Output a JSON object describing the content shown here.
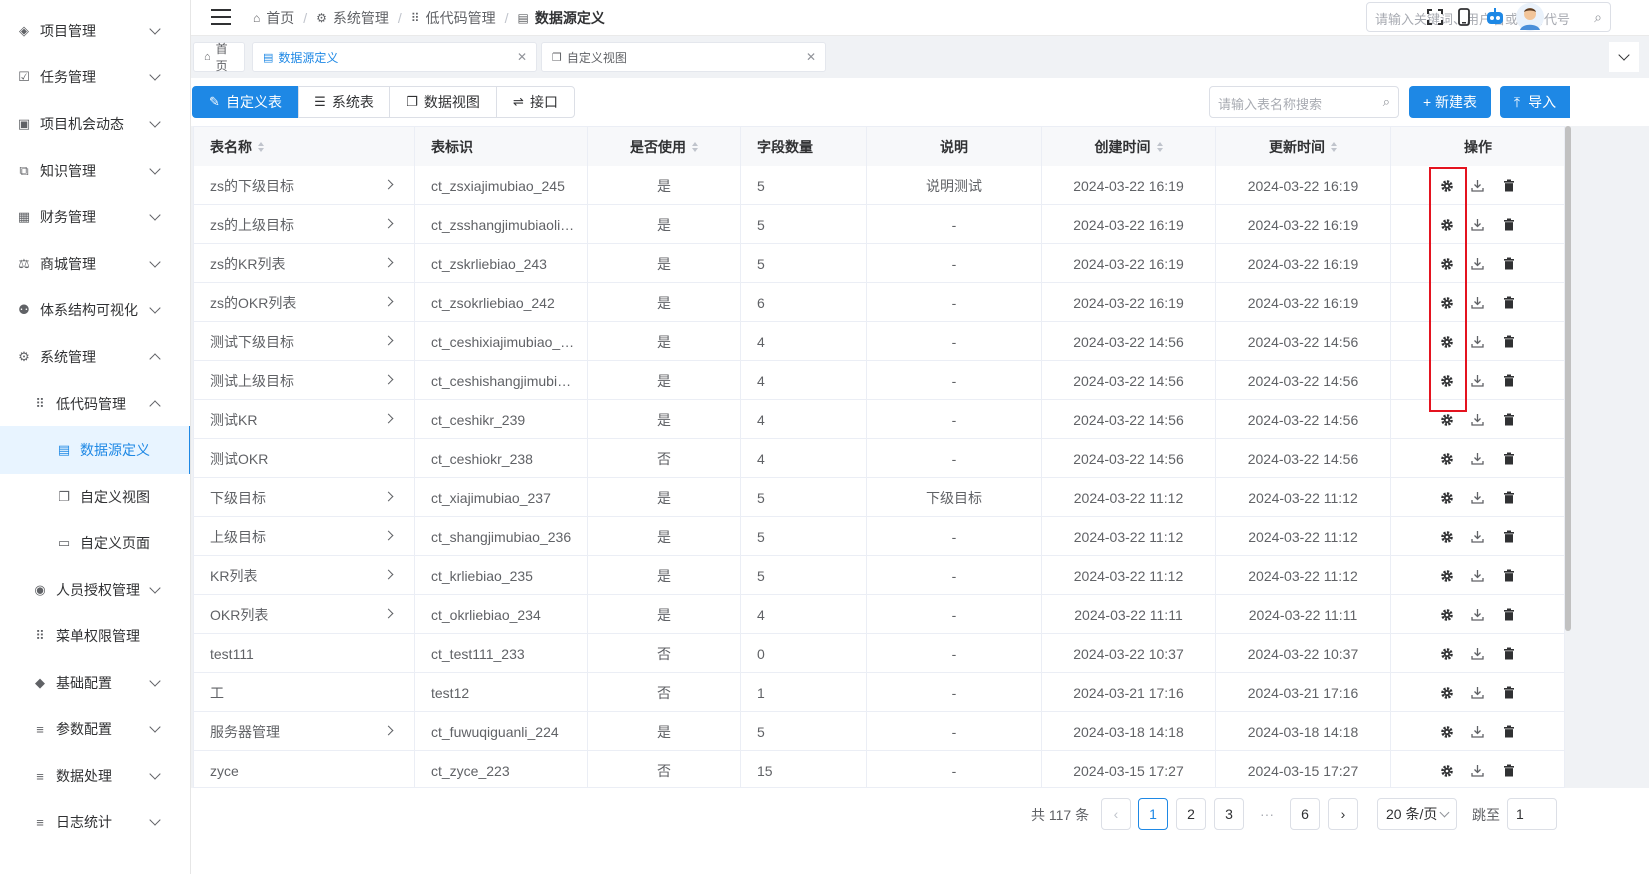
{
  "sidebar": {
    "items": [
      {
        "label": "项目管理",
        "icon": "layers-icon",
        "glyph": "◈",
        "expand": "down"
      },
      {
        "label": "任务管理",
        "icon": "task-check-icon",
        "glyph": "☑",
        "expand": "down"
      },
      {
        "label": "项目机会动态",
        "icon": "calendar-icon",
        "glyph": "▣",
        "expand": "down"
      },
      {
        "label": "知识管理",
        "icon": "book-icon",
        "glyph": "⧉",
        "expand": "down"
      },
      {
        "label": "财务管理",
        "icon": "grid-icon",
        "glyph": "▦",
        "expand": "down"
      },
      {
        "label": "商城管理",
        "icon": "shop-icon",
        "glyph": "⚖",
        "expand": "down"
      },
      {
        "label": "体系结构可视化",
        "icon": "user-tree-icon",
        "glyph": "⚉",
        "expand": "down"
      },
      {
        "label": "系统管理",
        "icon": "gear-icon",
        "glyph": "⚙",
        "expand": "up"
      },
      {
        "label": "低代码管理",
        "icon": "dots-grid-icon",
        "glyph": "⠿",
        "expand": "up"
      },
      {
        "label": "数据源定义",
        "icon": "document-icon",
        "glyph": "▤",
        "expand": "none",
        "active": true
      },
      {
        "label": "自定义视图",
        "icon": "copy-icon",
        "glyph": "❐",
        "expand": "none"
      },
      {
        "label": "自定义页面",
        "icon": "window-icon",
        "glyph": "▭",
        "expand": "none"
      },
      {
        "label": "人员授权管理",
        "icon": "user-circle-icon",
        "glyph": "◉",
        "expand": "down"
      },
      {
        "label": "菜单权限管理",
        "icon": "dots-grid-icon",
        "glyph": "⠿",
        "expand": "none"
      },
      {
        "label": "基础配置",
        "icon": "cube-icon",
        "glyph": "◆",
        "expand": "down"
      },
      {
        "label": "参数配置",
        "icon": "filter-icon",
        "glyph": "≡",
        "expand": "down"
      },
      {
        "label": "数据处理",
        "icon": "filter-icon",
        "glyph": "≡",
        "expand": "down"
      },
      {
        "label": "日志统计",
        "icon": "filter-icon",
        "glyph": "≡",
        "expand": "down"
      }
    ]
  },
  "breadcrumb": {
    "items": [
      "首页",
      "系统管理",
      "低代码管理",
      "数据源定义"
    ]
  },
  "global_search": {
    "placeholder": "请输入关键词、用户名或项目代号"
  },
  "tabs": [
    {
      "label": "首页"
    },
    {
      "label": "数据源定义",
      "active": true
    },
    {
      "label": "自定义视图"
    }
  ],
  "toolbar": {
    "segments": [
      {
        "label": "自定义表",
        "active": true
      },
      {
        "label": "系统表"
      },
      {
        "label": "数据视图"
      },
      {
        "label": "接口"
      }
    ],
    "search_placeholder": "请输入表名称搜索",
    "new_label": "+ 新建表",
    "import_label": "导入"
  },
  "table": {
    "headers": [
      "表名称",
      "表标识",
      "是否使用",
      "字段数量",
      "说明",
      "创建时间",
      "更新时间",
      "操作"
    ],
    "rows": [
      {
        "name": "zs的下级目标",
        "id": "ct_zsxiajimubiao_245",
        "used": "是",
        "fields": "5",
        "desc": "说明测试",
        "created": "2024-03-22 16:19",
        "updated": "2024-03-22 16:19",
        "arrow": true
      },
      {
        "name": "zs的上级目标",
        "id": "ct_zsshangjimubiaoli…",
        "used": "是",
        "fields": "5",
        "desc": "-",
        "created": "2024-03-22 16:19",
        "updated": "2024-03-22 16:19",
        "arrow": true
      },
      {
        "name": "zs的KR列表",
        "id": "ct_zskrliebiao_243",
        "used": "是",
        "fields": "5",
        "desc": "-",
        "created": "2024-03-22 16:19",
        "updated": "2024-03-22 16:19",
        "arrow": true
      },
      {
        "name": "zs的OKR列表",
        "id": "ct_zsokrliebiao_242",
        "used": "是",
        "fields": "6",
        "desc": "-",
        "created": "2024-03-22 16:19",
        "updated": "2024-03-22 16:19",
        "arrow": true
      },
      {
        "name": "测试下级目标",
        "id": "ct_ceshixiajimubiao_…",
        "used": "是",
        "fields": "4",
        "desc": "-",
        "created": "2024-03-22 14:56",
        "updated": "2024-03-22 14:56",
        "arrow": true
      },
      {
        "name": "测试上级目标",
        "id": "ct_ceshishangjimubi…",
        "used": "是",
        "fields": "4",
        "desc": "-",
        "created": "2024-03-22 14:56",
        "updated": "2024-03-22 14:56",
        "arrow": true
      },
      {
        "name": "测试KR",
        "id": "ct_ceshikr_239",
        "used": "是",
        "fields": "4",
        "desc": "-",
        "created": "2024-03-22 14:56",
        "updated": "2024-03-22 14:56",
        "arrow": true
      },
      {
        "name": "测试OKR",
        "id": "ct_ceshiokr_238",
        "used": "否",
        "fields": "4",
        "desc": "-",
        "created": "2024-03-22 14:56",
        "updated": "2024-03-22 14:56",
        "arrow": false
      },
      {
        "name": "下级目标",
        "id": "ct_xiajimubiao_237",
        "used": "是",
        "fields": "5",
        "desc": "下级目标",
        "created": "2024-03-22 11:12",
        "updated": "2024-03-22 11:12",
        "arrow": true
      },
      {
        "name": "上级目标",
        "id": "ct_shangjimubiao_236",
        "used": "是",
        "fields": "5",
        "desc": "-",
        "created": "2024-03-22 11:12",
        "updated": "2024-03-22 11:12",
        "arrow": true
      },
      {
        "name": "KR列表",
        "id": "ct_krliebiao_235",
        "used": "是",
        "fields": "5",
        "desc": "-",
        "created": "2024-03-22 11:12",
        "updated": "2024-03-22 11:12",
        "arrow": true
      },
      {
        "name": "OKR列表",
        "id": "ct_okrliebiao_234",
        "used": "是",
        "fields": "4",
        "desc": "-",
        "created": "2024-03-22 11:11",
        "updated": "2024-03-22 11:11",
        "arrow": true
      },
      {
        "name": "test111",
        "id": "ct_test111_233",
        "used": "否",
        "fields": "0",
        "desc": "-",
        "created": "2024-03-22 10:37",
        "updated": "2024-03-22 10:37",
        "arrow": false
      },
      {
        "name": "工",
        "id": "test12",
        "used": "否",
        "fields": "1",
        "desc": "-",
        "created": "2024-03-21 17:16",
        "updated": "2024-03-21 17:16",
        "arrow": false
      },
      {
        "name": "服务器管理",
        "id": "ct_fuwuqiguanli_224",
        "used": "是",
        "fields": "5",
        "desc": "-",
        "created": "2024-03-18 14:18",
        "updated": "2024-03-18 14:18",
        "arrow": true
      },
      {
        "name": "zyce",
        "id": "ct_zyce_223",
        "used": "否",
        "fields": "15",
        "desc": "-",
        "created": "2024-03-15 17:27",
        "updated": "2024-03-15 17:27",
        "arrow": false
      }
    ]
  },
  "pagination": {
    "total": "共 117 条",
    "pages": [
      "1",
      "2",
      "3",
      "···",
      "6"
    ],
    "current": "1",
    "page_size": "20 条/页",
    "jump_label": "跳至",
    "jump_value": "1"
  },
  "colors": {
    "primary": "#1e88e5",
    "highlight": "#e4131f"
  }
}
